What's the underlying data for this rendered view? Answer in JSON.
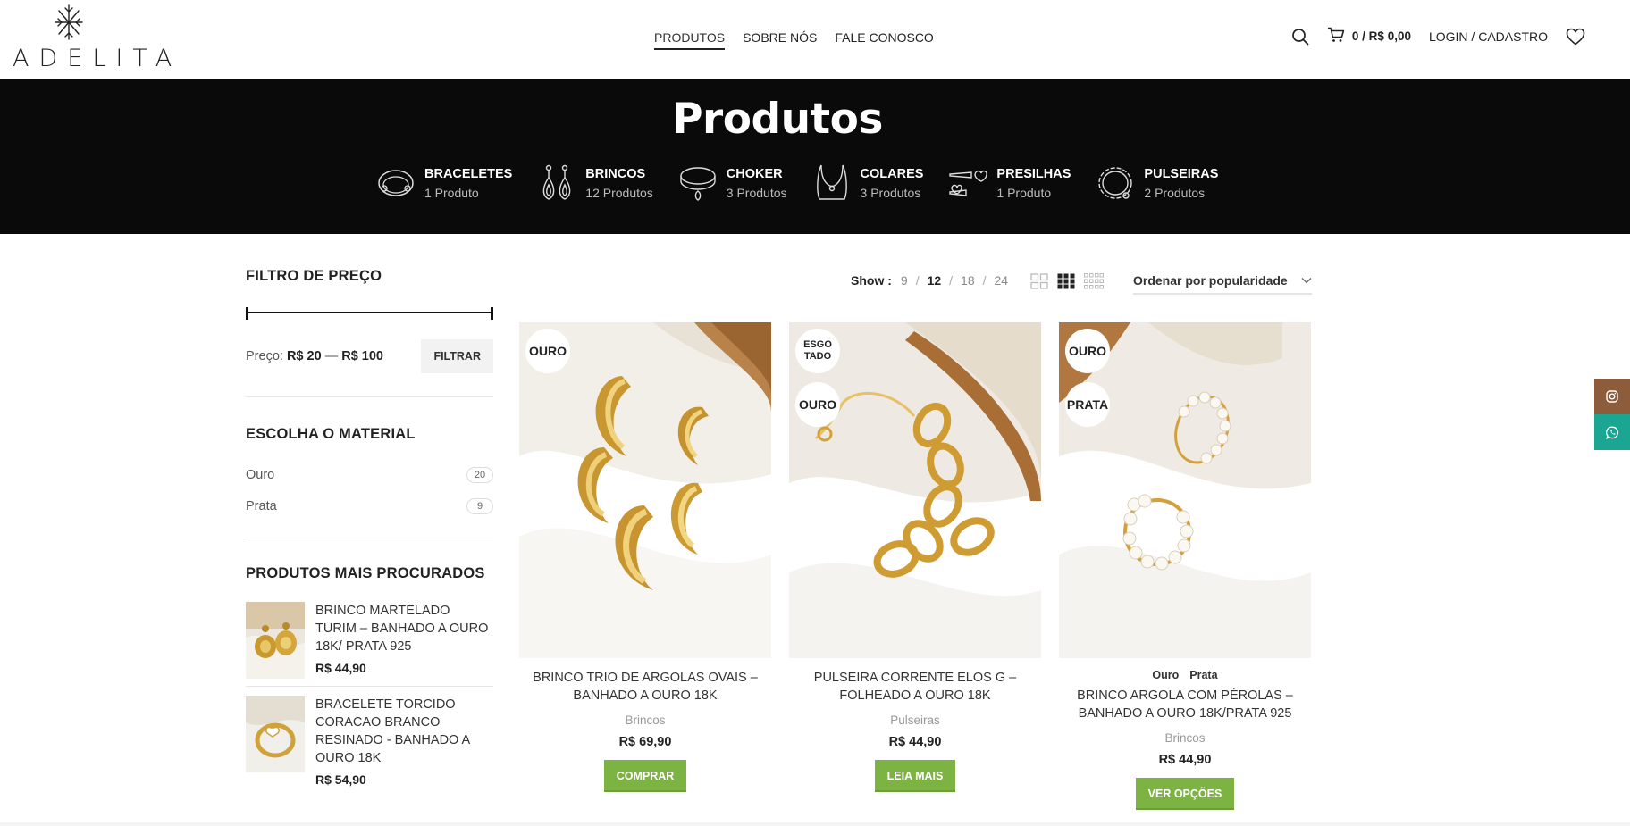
{
  "brand": {
    "name": "ADELITA"
  },
  "nav": {
    "items": [
      "PRODUTOS",
      "SOBRE NÓS",
      "FALE CONOSCO"
    ],
    "active": "PRODUTOS"
  },
  "header": {
    "cart_text": "0 / R$ 0,00",
    "login_label": "LOGIN / CADASTRO"
  },
  "hero": {
    "title": "Produtos",
    "categories": [
      {
        "name": "BRACELETES",
        "count": "1 Produto",
        "icon": "bracelet-icon"
      },
      {
        "name": "BRINCOS",
        "count": "12 Produtos",
        "icon": "earrings-icon"
      },
      {
        "name": "CHOKER",
        "count": "3 Produtos",
        "icon": "choker-icon"
      },
      {
        "name": "COLARES",
        "count": "3 Produtos",
        "icon": "necklace-icon"
      },
      {
        "name": "PRESILHAS",
        "count": "1 Produto",
        "icon": "hairclip-icon"
      },
      {
        "name": "PULSEIRAS",
        "count": "2 Produtos",
        "icon": "chain-bracelet-icon"
      }
    ]
  },
  "sidebar": {
    "price_filter": {
      "title": "FILTRO DE PREÇO",
      "label": "Preço:",
      "min": "R$ 20",
      "sep": "—",
      "max": "R$ 100",
      "button": "FILTRAR"
    },
    "material": {
      "title": "ESCOLHA O MATERIAL",
      "items": [
        {
          "name": "Ouro",
          "count": "20"
        },
        {
          "name": "Prata",
          "count": "9"
        }
      ]
    },
    "best": {
      "title": "PRODUTOS MAIS PROCURADOS",
      "items": [
        {
          "name": "BRINCO MARTELADO TURIM – BANHADO A OURO 18K/ PRATA 925",
          "price": "R$ 44,90"
        },
        {
          "name": "BRACELETE TORCIDO CORACAO BRANCO RESINADO - BANHADO A OURO 18K",
          "price": "R$ 54,90"
        }
      ]
    }
  },
  "toolbar": {
    "show_label": "Show :",
    "show_options": [
      "9",
      "12",
      "18",
      "24"
    ],
    "show_active": "12",
    "sort": "Ordenar por popularidade"
  },
  "products": [
    {
      "badges": [
        "OURO"
      ],
      "attrs": [],
      "name": "BRINCO TRIO DE ARGOLAS OVAIS – BANHADO A OURO 18K",
      "category": "Brincos",
      "price": "R$ 69,90",
      "button": "COMPRAR"
    },
    {
      "badges": [
        "ESGO TADO",
        "OURO"
      ],
      "attrs": [],
      "name": "PULSEIRA CORRENTE ELOS G – FOLHEADO A OURO 18K",
      "category": "Pulseiras",
      "price": "R$ 44,90",
      "button": "LEIA MAIS"
    },
    {
      "badges": [
        "OURO",
        "PRATA"
      ],
      "attrs": [
        "Ouro",
        "Prata"
      ],
      "name": "BRINCO ARGOLA COM PÉROLAS – BANHADO A OURO 18K/PRATA 925",
      "category": "Brincos",
      "price": "R$ 44,90",
      "button": "VER OPÇÕES"
    }
  ],
  "colors": {
    "accent_green": "#7cb342",
    "hero_bg": "#0a0a0a",
    "instagram_bg": "#8d5c3a",
    "whatsapp_bg": "#1aa692"
  }
}
